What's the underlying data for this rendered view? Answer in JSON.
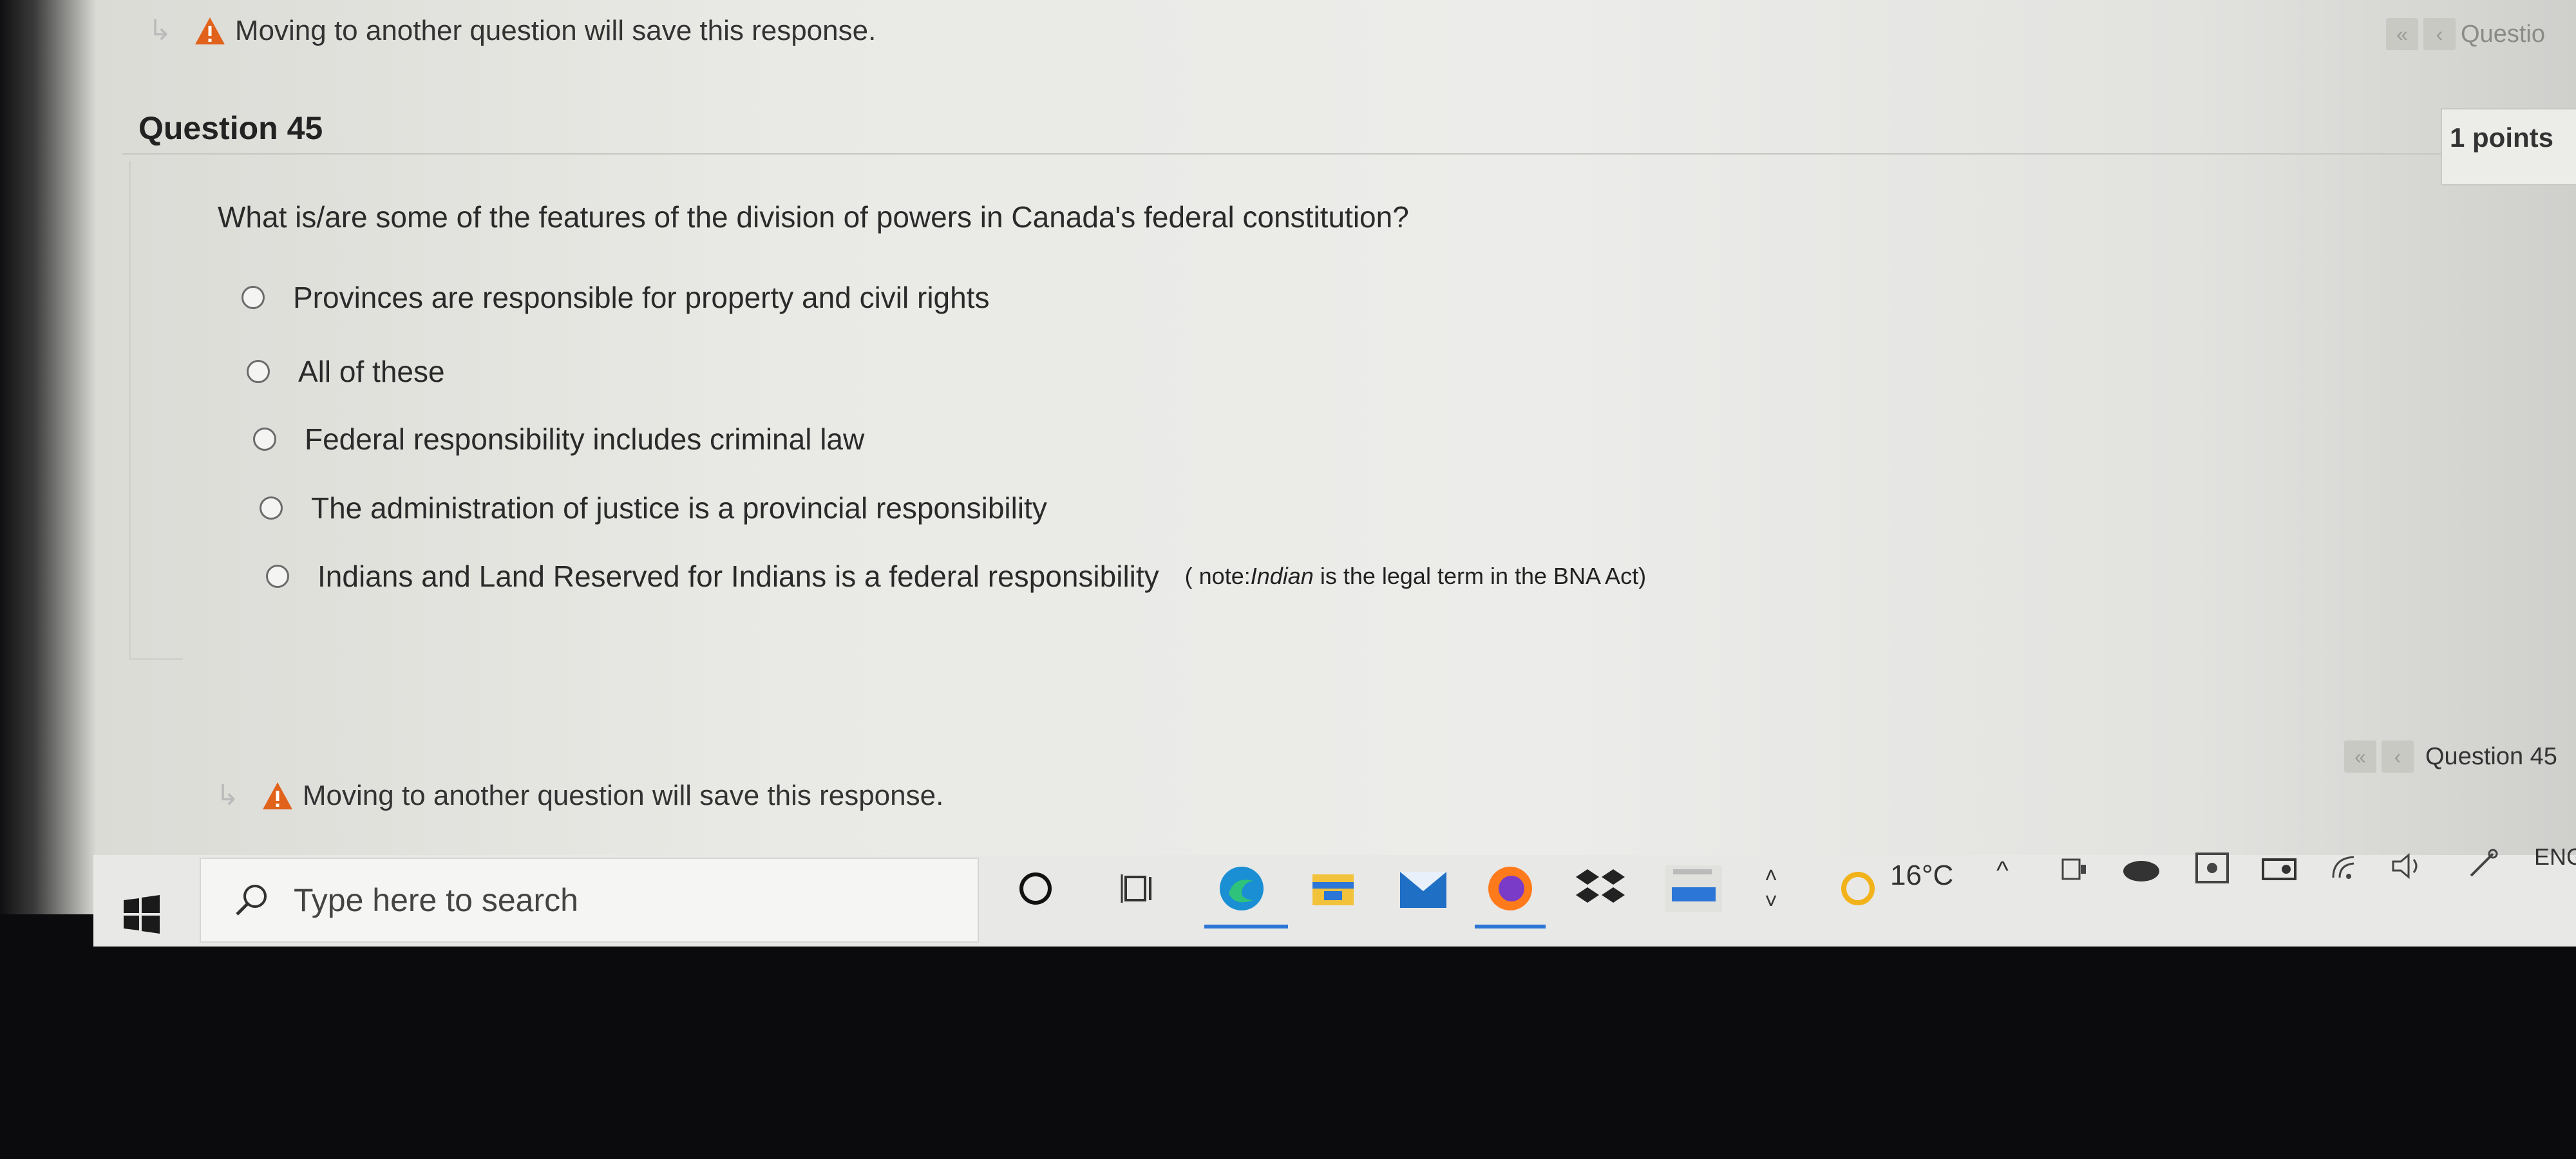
{
  "top_bar": {
    "warning_text": "Moving to another question will save this response.",
    "nav_label": "Questio"
  },
  "question": {
    "header": "Question 45",
    "points": "1 points",
    "text": "What is/are some of the features of the division of powers in Canada's federal constitution?",
    "options": [
      "Provinces are responsible for property and civil rights",
      "All of these",
      "Federal responsibility includes criminal law",
      "The administration of justice is a provincial responsibility",
      "Indians and Land Reserved for Indians is a federal responsibility"
    ],
    "option_note_prefix": "( note:",
    "option_note_italic": "Indian",
    "option_note_suffix": " is the legal term in the BNA Act)"
  },
  "bottom_bar": {
    "warning_text": "Moving to another question will save this response.",
    "nav_label": "Question 45"
  },
  "taskbar": {
    "search_placeholder": "Type here to search",
    "weather": "16°C",
    "language": "ENG",
    "icons": [
      "windows-start-icon",
      "cortana-icon",
      "task-view-icon",
      "edge-icon",
      "file-explorer-icon",
      "mail-icon",
      "firefox-icon",
      "dropbox-icon",
      "amazon-icon",
      "weather-icon",
      "show-hidden-icons",
      "meet-now-icon",
      "onedrive-icon",
      "security-icon",
      "storage-icon",
      "wifi-icon",
      "volume-icon",
      "pen-icon"
    ]
  },
  "colors": {
    "accent_blue": "#2b76d6",
    "warning_orange": "#e0621b"
  }
}
